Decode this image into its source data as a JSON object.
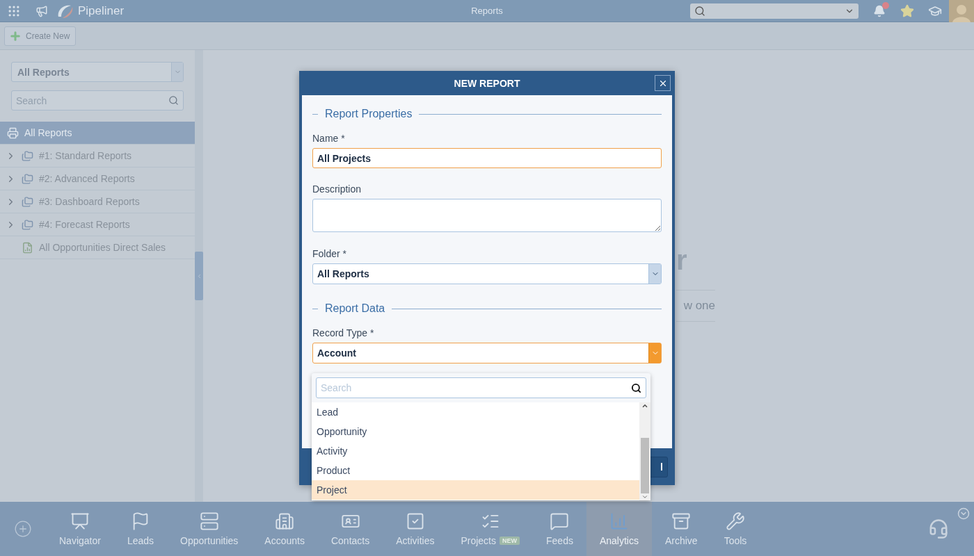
{
  "top_bar": {
    "brand": "Pipeliner",
    "title": "Reports",
    "notification_badge": true
  },
  "toolbar": {
    "create_button": "Create New"
  },
  "sidebar": {
    "folder_select": "All Reports",
    "search": {
      "placeholder": "Search"
    },
    "items": [
      {
        "label": "All Reports",
        "kind": "root",
        "selected": true
      },
      {
        "label": "#1: Standard Reports",
        "kind": "folder",
        "selected": false
      },
      {
        "label": "#2: Advanced Reports",
        "kind": "folder",
        "selected": false
      },
      {
        "label": "#3: Dashboard Reports",
        "kind": "folder",
        "selected": false
      },
      {
        "label": "#4: Forecast Reports",
        "kind": "folder",
        "selected": false
      },
      {
        "label": "All Opportunities Direct Sales",
        "kind": "report",
        "selected": false
      }
    ]
  },
  "background": {
    "heading": "r",
    "hint": "w one"
  },
  "dialog": {
    "title": "NEW REPORT",
    "sections": [
      {
        "title": "Report Properties",
        "fields": [
          {
            "label": "Name *",
            "kind": "text",
            "value": "All Projects",
            "focused": true
          },
          {
            "label": "Description",
            "kind": "textarea",
            "focused": false
          },
          {
            "label": "Folder *",
            "kind": "select",
            "value": "All Reports",
            "focused": false
          }
        ]
      },
      {
        "title": "Report Data",
        "fields": [
          {
            "label": "Record Type *",
            "kind": "select",
            "value": "Account",
            "focused": true
          }
        ]
      }
    ],
    "footer_button": "l",
    "dropdown": {
      "search": {
        "placeholder": "Search"
      },
      "options": [
        {
          "label": "Lead",
          "selected": false
        },
        {
          "label": "Opportunity",
          "selected": false
        },
        {
          "label": "Activity",
          "selected": false
        },
        {
          "label": "Product",
          "selected": false
        },
        {
          "label": "Project",
          "selected": true
        }
      ]
    }
  },
  "bottom_nav": {
    "items": [
      {
        "label": "Navigator",
        "kind": "navigator",
        "selected": false
      },
      {
        "label": "Leads",
        "kind": "leads",
        "selected": false
      },
      {
        "label": "Opportunities",
        "kind": "opportunities",
        "selected": false
      },
      {
        "label": "Accounts",
        "kind": "accounts",
        "selected": false
      },
      {
        "label": "Contacts",
        "kind": "contacts",
        "selected": false
      },
      {
        "label": "Activities",
        "kind": "activities",
        "selected": false
      },
      {
        "label": "Projects",
        "kind": "projects",
        "selected": false,
        "badge": "NEW"
      },
      {
        "label": "Feeds",
        "kind": "feeds",
        "selected": false
      },
      {
        "label": "Analytics",
        "kind": "analytics",
        "selected": true
      },
      {
        "label": "Archive",
        "kind": "archive",
        "selected": false
      },
      {
        "label": "Tools",
        "kind": "tools",
        "selected": false
      }
    ]
  }
}
